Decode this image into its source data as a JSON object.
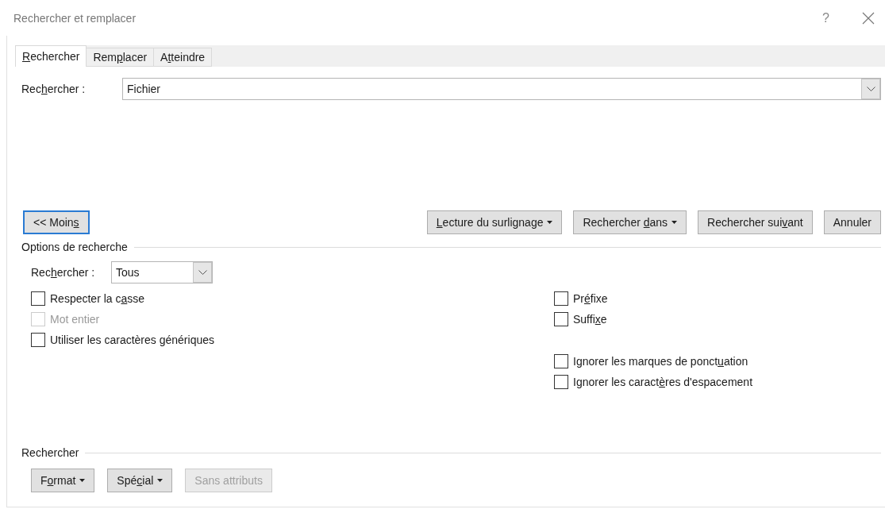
{
  "window": {
    "title": "Rechercher et remplacer",
    "help": "?"
  },
  "tabs": [
    {
      "label": {
        "key": "R",
        "post": "echercher"
      },
      "selected": true
    },
    {
      "label": {
        "pre": "Rem",
        "key": "p",
        "post": "lacer"
      },
      "selected": false
    },
    {
      "label": {
        "pre": "A",
        "key": "t",
        "post": "teindre"
      },
      "selected": false
    }
  ],
  "find": {
    "label": {
      "pre": "Rec",
      "key": "h",
      "post": "ercher :"
    },
    "value": "Fichier"
  },
  "buttons": {
    "less": {
      "label": {
        "pre": "<< Moin",
        "key": "s"
      },
      "focused": true
    },
    "actions": [
      {
        "label": {
          "key": "L",
          "post": "ecture du surlignage"
        },
        "kind": "menu"
      },
      {
        "label": {
          "pre": "Rechercher ",
          "key": "d",
          "post": "ans"
        },
        "kind": "menu"
      },
      {
        "label": {
          "pre": "Rechercher sui",
          "key": "v",
          "post": "ant"
        },
        "kind": "plain"
      },
      {
        "label": "Annuler",
        "kind": "plain"
      }
    ]
  },
  "options": {
    "title": "Options de recherche",
    "direction": {
      "label": {
        "pre": "Rec",
        "key": "h",
        "post": "ercher :"
      },
      "value": "Tous"
    },
    "left": [
      {
        "label": {
          "pre": "Respecter la c",
          "key": "a",
          "post": "sse"
        },
        "checked": false,
        "disabled": false
      },
      {
        "label": "Mot entier",
        "checked": false,
        "disabled": true
      },
      {
        "label": {
          "pre": "Utiliser les caractères ",
          "key": "g",
          "post": "énériques"
        },
        "checked": false,
        "disabled": false
      }
    ],
    "right_groups": [
      [
        {
          "label": {
            "pre": "Pr",
            "key": "é",
            "post": "fixe"
          },
          "checked": false,
          "disabled": false
        },
        {
          "label": {
            "pre": "Suffi",
            "key": "x",
            "post": "e"
          },
          "checked": false,
          "disabled": false
        }
      ],
      [
        {
          "label": {
            "pre": "Ignorer les marques de ponct",
            "key": "u",
            "post": "ation"
          },
          "checked": false,
          "disabled": false
        },
        {
          "label": {
            "pre": "Ignorer les caract",
            "key": "è",
            "post": "res d'espacement"
          },
          "checked": false,
          "disabled": false
        }
      ]
    ]
  },
  "find_section": {
    "title": "Rechercher",
    "buttons": [
      {
        "label": {
          "pre": "F",
          "key": "o",
          "post": "rmat"
        },
        "kind": "menu",
        "disabled": false
      },
      {
        "label": {
          "pre": "Spé",
          "key": "c",
          "post": "ial"
        },
        "kind": "menu",
        "disabled": false
      },
      {
        "label": "Sans attributs",
        "kind": "plain",
        "disabled": true
      }
    ]
  }
}
